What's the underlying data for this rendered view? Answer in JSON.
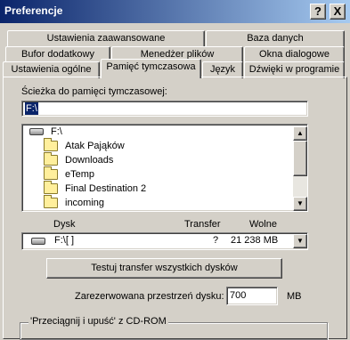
{
  "window": {
    "title": "Preferencje",
    "help_button": "?",
    "close_button": "X"
  },
  "tabs": {
    "row1": [
      "Ustawienia zaawansowane",
      "Baza danych"
    ],
    "row2": [
      "Bufor dodatkowy",
      "Menedżer plików",
      "Okna dialogowe"
    ],
    "row3": [
      "Ustawienia ogólne",
      "Pamięć tymczasowa",
      "Język",
      "Dźwięki w programie"
    ],
    "active": "Pamięć tymczasowa"
  },
  "cache_path": {
    "label": "Ścieżka do pamięci tymczasowej:",
    "value": "F:\\"
  },
  "folder_list": {
    "root": "F:\\",
    "items": [
      "Atak Pająków",
      "Downloads",
      "eTemp",
      "Final Destination 2",
      "incoming"
    ]
  },
  "disk_table": {
    "columns": [
      "Dysk",
      "Transfer",
      "Wolne"
    ],
    "selected_drive": "F:\\[ ]",
    "transfer": "?",
    "free": "21 238 MB"
  },
  "test_button": "Testuj transfer wszystkich dysków",
  "reserved": {
    "label": "Zarezerwowana przestrzeń dysku:",
    "value": "700",
    "unit": "MB"
  },
  "cdrom_group": {
    "label": "'Przeciągnij i upuść' z CD-ROM"
  }
}
